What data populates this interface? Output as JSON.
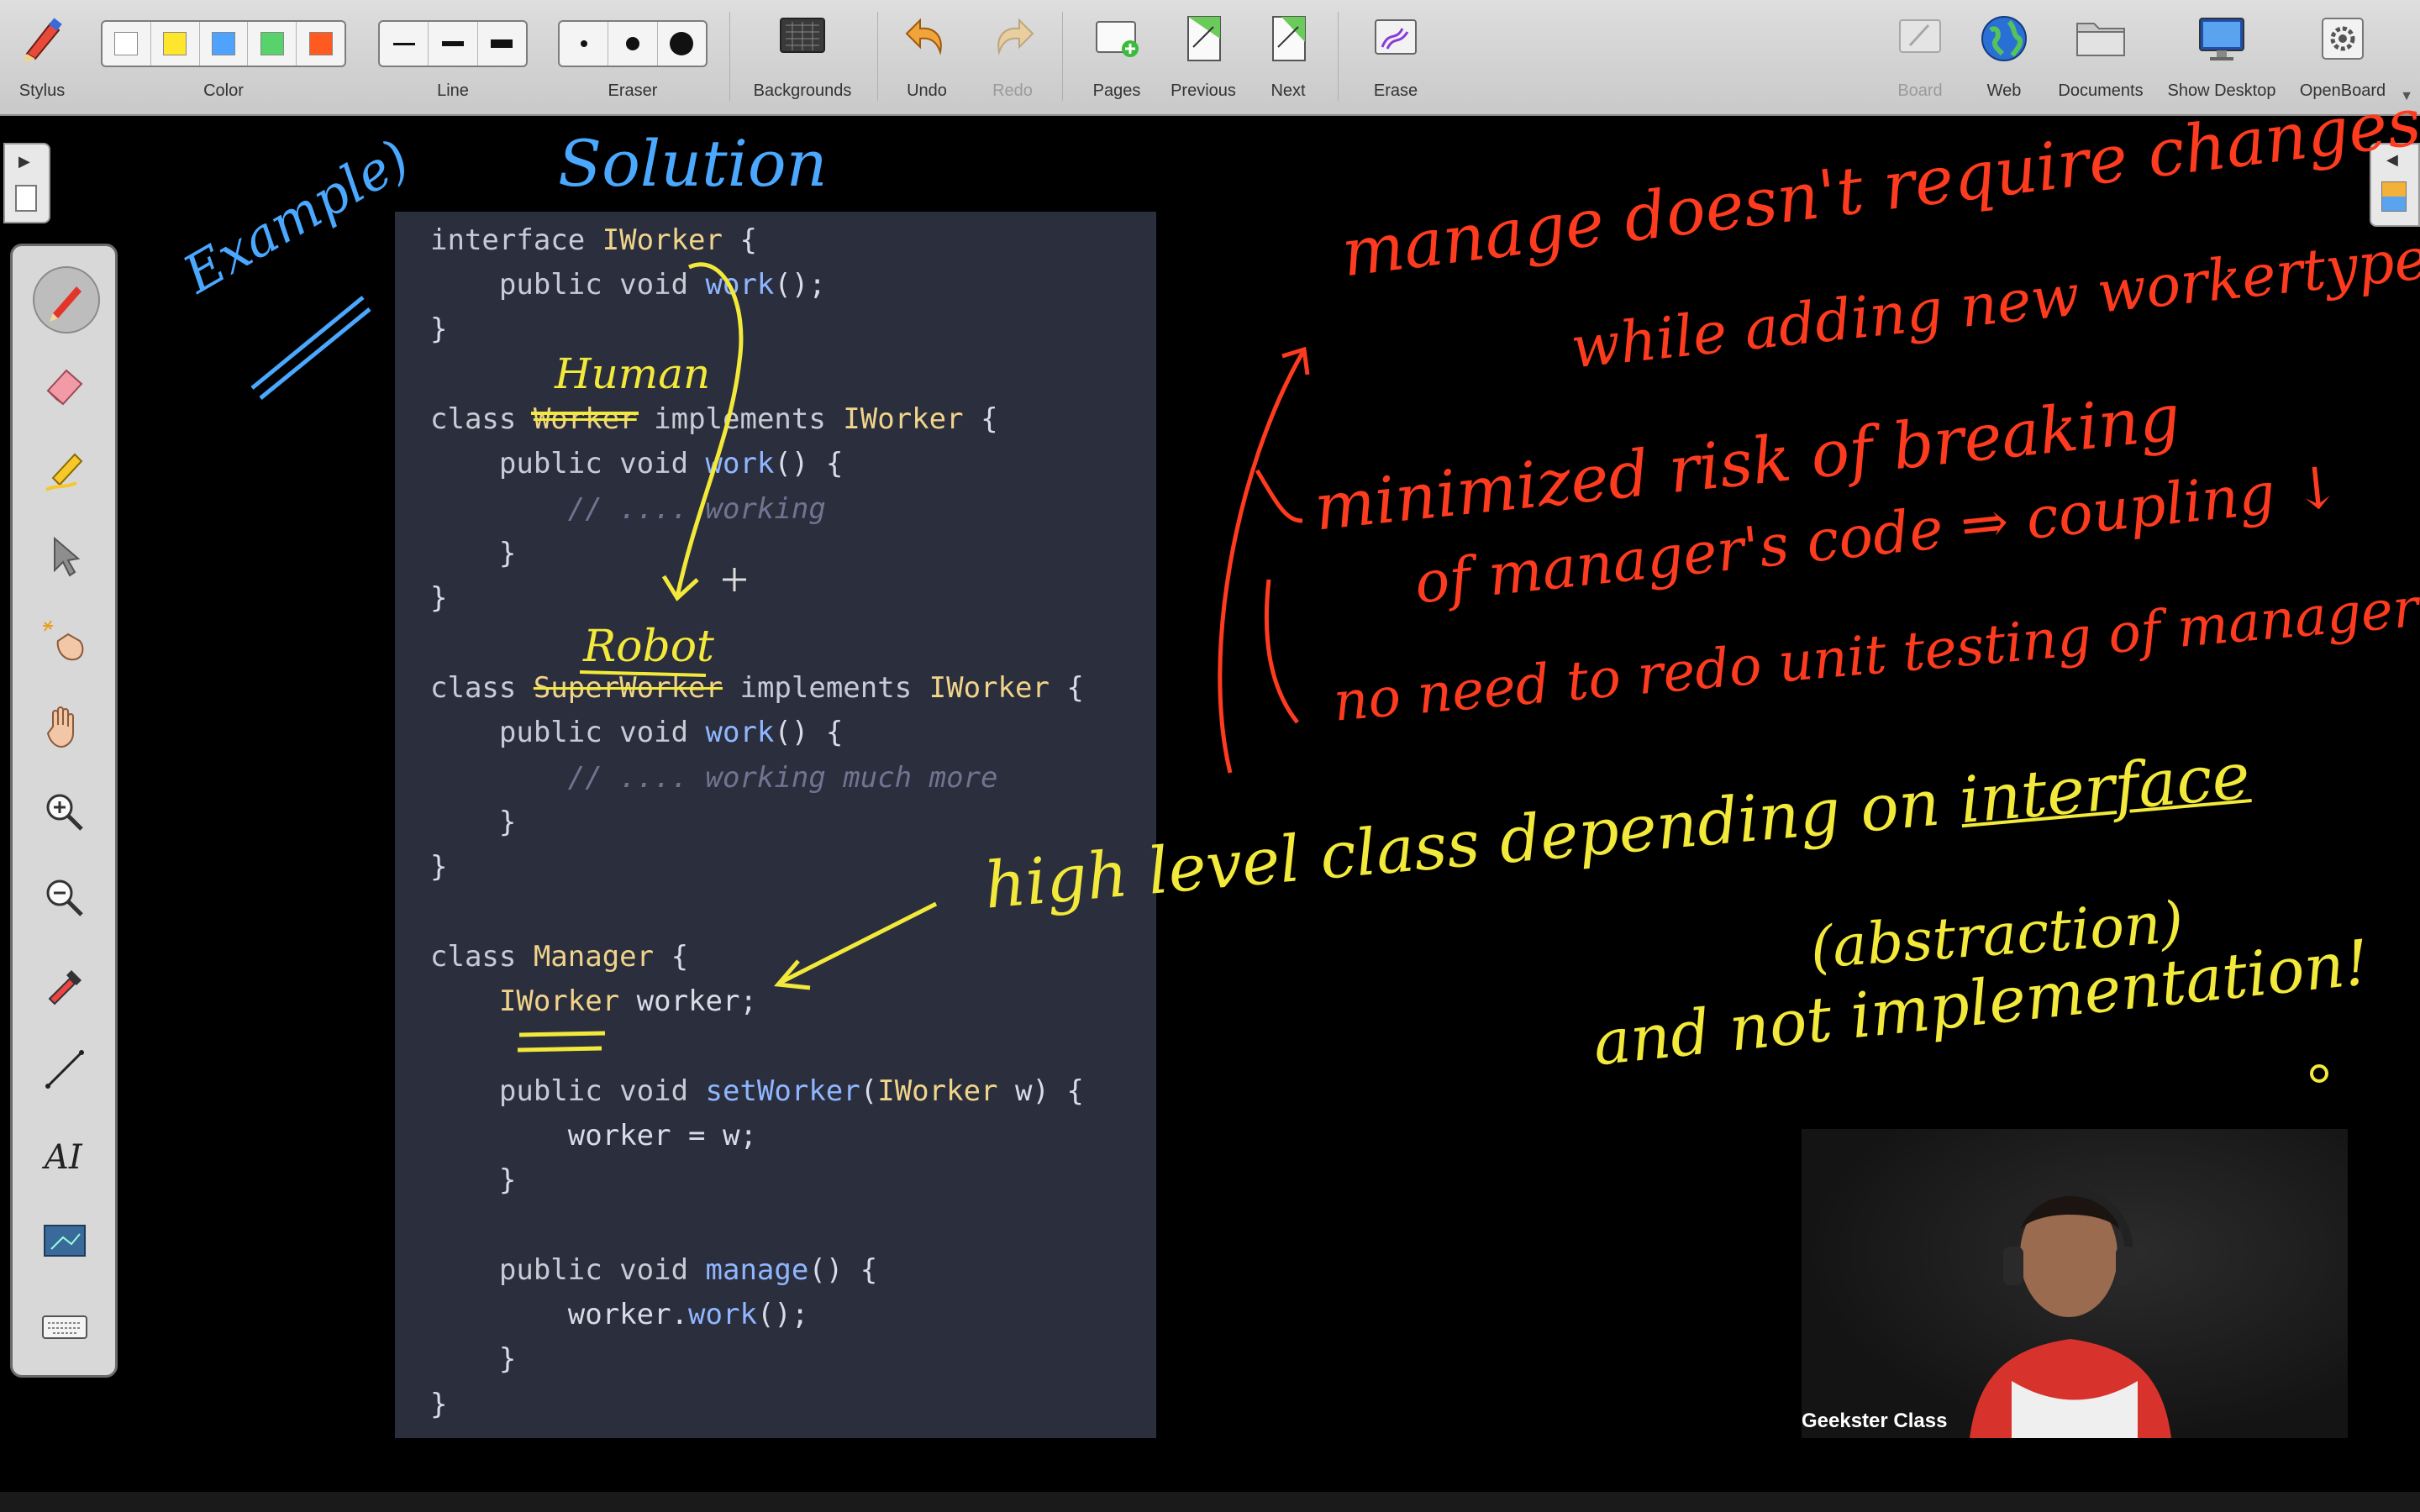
{
  "toolbar": {
    "stylus": "Stylus",
    "color": "Color",
    "line": "Line",
    "eraser": "Eraser",
    "backgrounds": "Backgrounds",
    "undo": "Undo",
    "redo": "Redo",
    "pages": "Pages",
    "previous": "Previous",
    "next": "Next",
    "erase": "Erase",
    "board": "Board",
    "web": "Web",
    "documents": "Documents",
    "show_desktop": "Show Desktop",
    "openboard": "OpenBoard",
    "swatches": [
      "#ffffff",
      "#ffe62e",
      "#4fa3ff",
      "#58d26a",
      "#ff5a1f"
    ]
  },
  "palette": {
    "tools": [
      "pen-icon",
      "eraser-icon",
      "marker-icon",
      "selector-icon",
      "laser-pointer-icon",
      "hand-icon",
      "zoom-in-icon",
      "zoom-out-icon",
      "color-picker-icon",
      "line-icon",
      "text-icon",
      "capture-icon",
      "keyboard-icon"
    ]
  },
  "code": {
    "l1a": "interface ",
    "l1b": "IWorker",
    "l1c": " {",
    "l2a": "    public void ",
    "l2b": "work",
    "l2c": "();",
    "l3": "}",
    "l4a": "class ",
    "l4b": "Worker",
    "l4c": " implements ",
    "l4d": "IWorker",
    "l4e": " {",
    "l5a": "    public void ",
    "l5b": "work",
    "l5c": "() {",
    "l6": "        // .... working",
    "l7": "    }",
    "l8": "}",
    "l9a": "class ",
    "l9b": "SuperWorker",
    "l9c": " implements ",
    "l9d": "IWorker",
    "l9e": " {",
    "l10a": "    public void ",
    "l10b": "work",
    "l10c": "() {",
    "l11": "        // .... working much more",
    "l12": "    }",
    "l13": "}",
    "l14a": "class ",
    "l14b": "Manager",
    "l14c": " {",
    "l15a": "    ",
    "l15b": "IWorker",
    "l15c": " worker;",
    "l16a": "    public void ",
    "l16b": "setWorker",
    "l16c": "(",
    "l16d": "IWorker",
    "l16e": " w) {",
    "l17": "        worker = w;",
    "l18": "    }",
    "l19a": "    public void ",
    "l19b": "manage",
    "l19c": "() {",
    "l20a": "        worker.",
    "l20b": "work",
    "l20c": "();",
    "l21": "    }",
    "l22": "}"
  },
  "annotations": {
    "solution": "Solution",
    "example": "Example)",
    "human": "Human",
    "robot": "Robot",
    "red1": "manage doesn't require changes",
    "red2": "while adding new workertype",
    "red3": "minimized risk of breaking",
    "red4": "of manager's code ⇒ coupling ↓",
    "red5": "no need to redo unit testing of manager",
    "y1a": "high level class depending on ",
    "y1b": "interface",
    "y2": "(abstraction)",
    "y3": "and not implementation!"
  },
  "webcam": {
    "name": "Geekster Class"
  }
}
